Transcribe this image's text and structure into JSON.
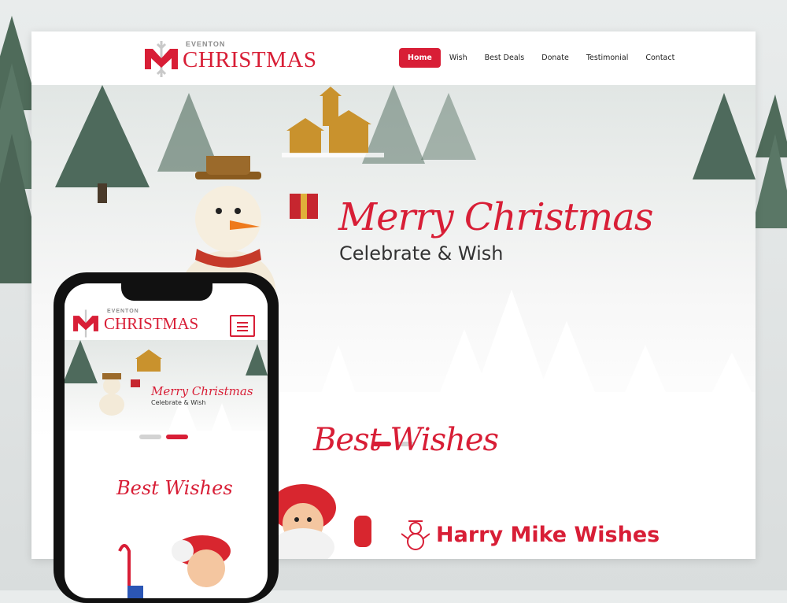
{
  "site": {
    "logo_small": "EVENTON",
    "logo_big": "CHRISTMAS"
  },
  "nav": {
    "items": [
      {
        "label": "Home",
        "active": true
      },
      {
        "label": "Wish",
        "active": false
      },
      {
        "label": "Best Deals",
        "active": false
      },
      {
        "label": "Donate",
        "active": false
      },
      {
        "label": "Testimonial",
        "active": false
      },
      {
        "label": "Contact",
        "active": false
      }
    ]
  },
  "hero": {
    "title": "Merry Christmas",
    "subtitle": "Celebrate & Wish",
    "slide_count": 2,
    "active_slide": 1
  },
  "wishes": {
    "section_title": "Best Wishes",
    "card_title": "Harry Mike Wishes"
  },
  "mobile": {
    "logo_small": "EVENTON",
    "logo_big": "CHRISTMAS",
    "hero_title": "Merry Christmas",
    "hero_subtitle": "Celebrate & Wish",
    "section_title": "Best Wishes",
    "active_slide": 2
  },
  "colors": {
    "accent": "#d81e36",
    "text": "#333333"
  }
}
